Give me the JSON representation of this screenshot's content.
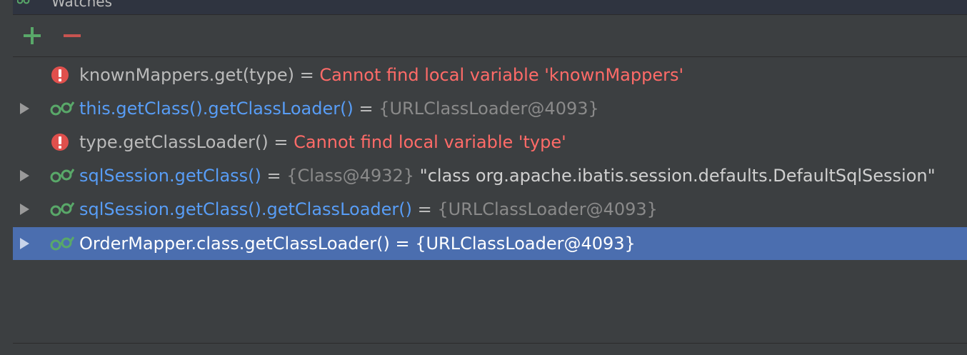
{
  "panel": {
    "title": "Watches",
    "icon": "watches-glasses-icon"
  },
  "toolbar": {
    "add_icon": "plus-icon",
    "remove_icon": "minus-icon",
    "add_color": "#59a869",
    "remove_color": "#c75450"
  },
  "watches": [
    {
      "icon": "error-icon",
      "expandable": false,
      "expression": "knownMappers.get(type)",
      "separator": " = ",
      "value": "Cannot find local variable 'knownMappers'",
      "value_kind": "error"
    },
    {
      "icon": "watch-glasses-icon",
      "expandable": true,
      "expression": "this.getClass().getClassLoader()",
      "separator": " = ",
      "value": "{URLClassLoader@4093}",
      "value_kind": "ref"
    },
    {
      "icon": "error-icon",
      "expandable": false,
      "expression": "type.getClassLoader()",
      "separator": " = ",
      "value": "Cannot find local variable 'type'",
      "value_kind": "error"
    },
    {
      "icon": "watch-glasses-icon",
      "expandable": true,
      "expression": "sqlSession.getClass()",
      "separator": " = ",
      "value": "{Class@4932}",
      "value_extra": " \"class org.apache.ibatis.session.defaults.DefaultSqlSession\"",
      "value_kind": "ref"
    },
    {
      "icon": "watch-glasses-icon",
      "expandable": true,
      "expression": "sqlSession.getClass().getClassLoader()",
      "separator": " = ",
      "value": "{URLClassLoader@4093}",
      "value_kind": "ref"
    },
    {
      "icon": "watch-glasses-icon",
      "expandable": true,
      "expression": "OrderMapper.class.getClassLoader()",
      "separator": " = ",
      "value": "{URLClassLoader@4093}",
      "value_kind": "ref",
      "selected": true
    }
  ],
  "colors": {
    "background": "#3c3f41",
    "selection": "#4b6eaf",
    "error_text": "#ff6b68",
    "link_text": "#589df6",
    "ref_text": "#8a8a8a"
  }
}
